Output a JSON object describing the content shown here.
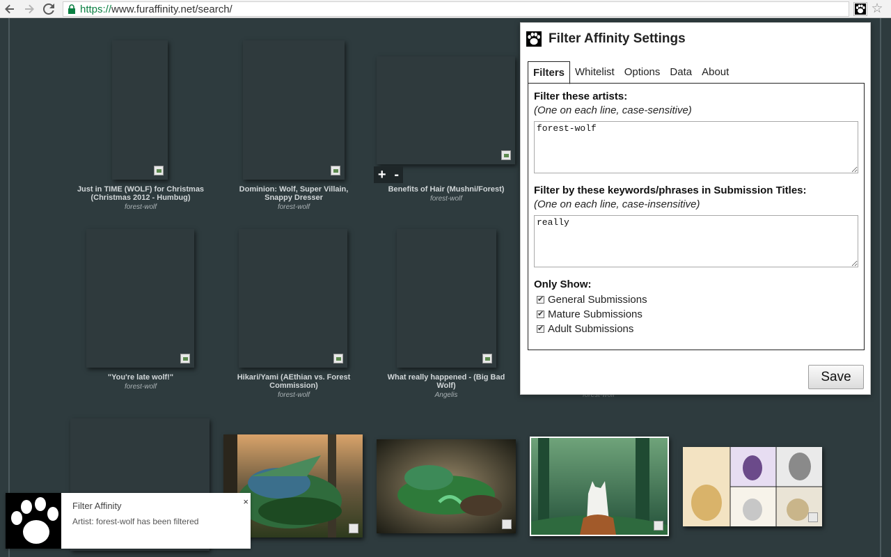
{
  "browser": {
    "url_scheme": "https://",
    "url_rest": "www.furaffinity.net/search/"
  },
  "gallery": {
    "row1": [
      {
        "title_line1": "Just in TIME (WOLF) for Christmas",
        "title_line2": "(Christmas 2012 - Humbug)",
        "artist": "forest-wolf"
      },
      {
        "title_line1": "Dominion: Wolf, Super Villain,",
        "title_line2": "Snappy Dresser",
        "artist": "forest-wolf"
      },
      {
        "title_line1": "Benefits of Hair (Mushni/Forest)",
        "title_line2": "",
        "artist": "forest-wolf"
      }
    ],
    "row2": [
      {
        "title_line1": "\"You're late wolf!\"",
        "title_line2": "",
        "artist": "forest-wolf"
      },
      {
        "title_line1": "Hikari/Yami (AEthian vs. Forest",
        "title_line2": "Commission)",
        "artist": "forest-wolf"
      },
      {
        "title_line1": "What really happened - (Big Bad",
        "title_line2": "Wolf)",
        "artist": "Angelis"
      }
    ],
    "hidden_artist": "forest-wolf",
    "plus": "+",
    "minus": "-"
  },
  "popup": {
    "title": "Filter Affinity Settings",
    "tabs": [
      "Filters",
      "Whitelist",
      "Options",
      "Data",
      "About"
    ],
    "artists_label": "Filter these artists:",
    "artists_hint": "(One on each line, case-sensitive)",
    "artists_value": "forest-wolf",
    "keywords_label": "Filter by these keywords/phrases in Submission Titles:",
    "keywords_hint": "(One on each line, case-insensitive)",
    "keywords_value": "really",
    "only_show_label": "Only Show:",
    "checkboxes": [
      {
        "label": "General Submissions",
        "checked": true
      },
      {
        "label": "Mature Submissions",
        "checked": true
      },
      {
        "label": "Adult Submissions",
        "checked": true
      }
    ],
    "save_label": "Save"
  },
  "notification": {
    "title": "Filter Affinity",
    "message": "Artist: forest-wolf has been filtered",
    "close": "×"
  }
}
